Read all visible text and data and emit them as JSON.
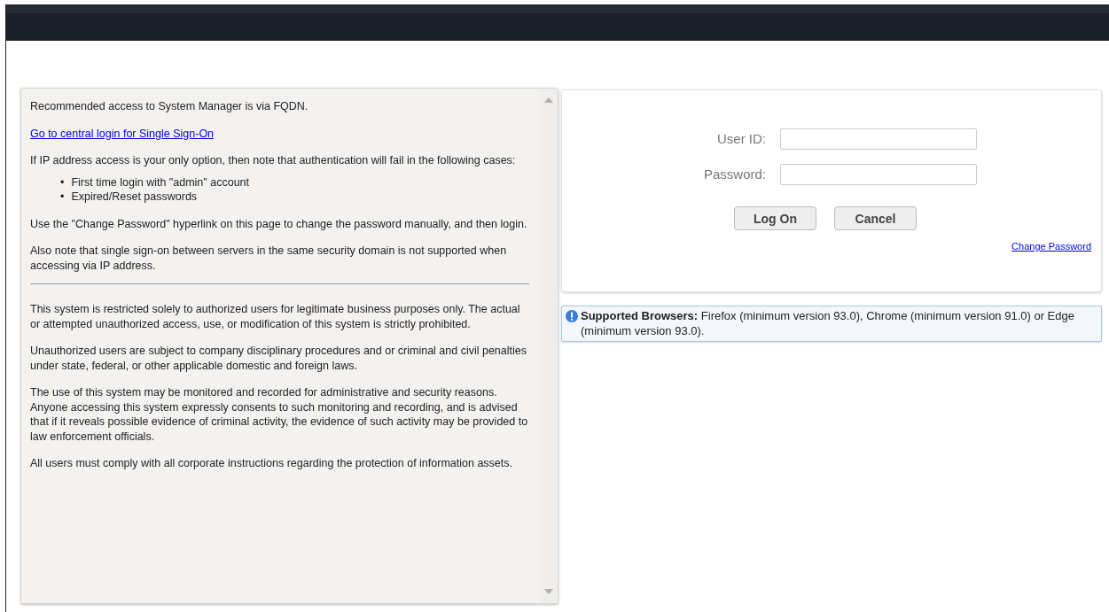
{
  "info_panel": {
    "access_notes": [
      {
        "kind": "text",
        "text": "Recommended access to System Manager is via FQDN."
      },
      {
        "kind": "link",
        "text": "Go to central login for Single Sign-On"
      },
      {
        "kind": "text",
        "text": "If IP address access is your only option, then note that authentication will fail in the following cases:"
      },
      {
        "kind": "list",
        "marker": "•",
        "items": [
          "First time login with \"admin\" account",
          "Expired/Reset passwords"
        ]
      },
      {
        "kind": "text",
        "text": "Use the \"Change Password\" hyperlink on this page to change the password manually, and then login."
      },
      {
        "kind": "text",
        "text": "Also note that single sign-on between servers in the same security domain is not supported when accessing via IP address."
      }
    ],
    "legal_notice": [
      "This system is restricted solely to authorized users for legitimate business purposes only. The actual or attempted unauthorized access, use, or modification of this system is strictly prohibited.",
      "Unauthorized users are subject to company disciplinary procedures and or criminal and civil penalties under state, federal, or other applicable domestic and foreign laws.",
      "The use of this system may be monitored and recorded for administrative and security reasons. Anyone accessing this system expressly consents to such monitoring and recording, and is advised that if it reveals possible evidence of criminal activity, the evidence of such activity may be provided to law enforcement officials.",
      "All users must comply with all corporate instructions regarding the protection of information assets."
    ]
  },
  "login": {
    "fields": [
      {
        "label": "User ID:"
      },
      {
        "label": "Password:"
      }
    ],
    "buttons": [
      "Log On",
      "Cancel"
    ],
    "change_password_link": "Change Password"
  },
  "browser_notice": "**Supported Browsers:** Firefox (minimum version 93.0), Chrome (minimum version 91.0) or Edge (minimum version 93.0)."
}
